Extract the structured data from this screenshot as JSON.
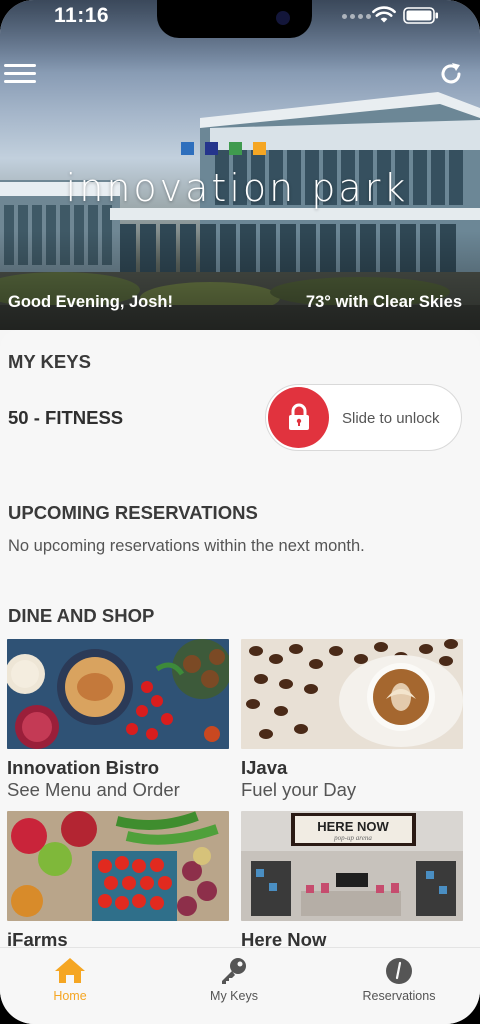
{
  "status_bar": {
    "time": "11:16"
  },
  "hero": {
    "brand": "innovation park",
    "logo_colors": [
      "#2e6fbd",
      "#25358c",
      "#3f9a4e",
      "#f5a623"
    ],
    "greeting": "Good Evening, Josh!",
    "weather": "73° with Clear Skies",
    "menu_icon": "hamburger-menu-icon",
    "refresh_icon": "refresh-icon"
  },
  "keys": {
    "title": "MY KEYS",
    "key_name": "50 - FITNESS",
    "unlock_label": "Slide to unlock",
    "lock_color": "#e1333e"
  },
  "reservations": {
    "title": "UPCOMING RESERVATIONS",
    "empty_text": "No upcoming reservations within the next month."
  },
  "dine": {
    "title": "DINE AND SHOP",
    "items": [
      {
        "name": "Innovation Bistro",
        "subtitle": "See Menu and Order"
      },
      {
        "name": "IJava",
        "subtitle": "Fuel your Day"
      },
      {
        "name": "iFarms",
        "subtitle": ""
      },
      {
        "name": "Here Now",
        "subtitle": "",
        "sign_text": "HERE NOW",
        "sign_sub": "pop-up arena"
      }
    ]
  },
  "tabbar": {
    "accent": "#f5a623",
    "tabs": [
      {
        "label": "Home",
        "icon": "home-icon",
        "active": true
      },
      {
        "label": "My Keys",
        "icon": "key-icon",
        "active": false
      },
      {
        "label": "Reservations",
        "icon": "reservations-icon",
        "active": false
      }
    ]
  }
}
